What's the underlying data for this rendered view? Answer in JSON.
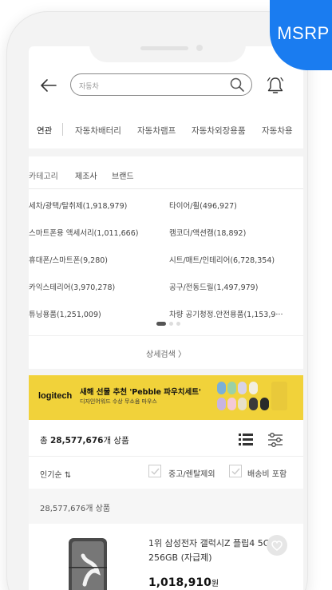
{
  "badge": {
    "label": "MSRP",
    "color": "#1a7cf0"
  },
  "header": {
    "search_value": "자동차"
  },
  "related": {
    "label": "연관",
    "keywords": [
      "자동차배터리",
      "자동차램프",
      "자동차외장용품",
      "자동차용"
    ]
  },
  "category_tabs": [
    "카테고리",
    "제조사",
    "브랜드"
  ],
  "categories": [
    "세차/광택/탈취제(1,918,979)",
    "타이어/휠(496,927)",
    "스마트폰용 액세서리(1,011,666)",
    "캠코더/액션캠(18,892)",
    "휴대폰/스마트폰(9,280)",
    "시트/매트/인테리어(6,728,354)",
    "카익스테리어(3,970,278)",
    "공구/전동드릴(1,497,979)",
    "튜닝용품(1,251,009)",
    "차량 공기청정.안전용품(1,153,9···"
  ],
  "detail_search": "상세검색 〉",
  "banner": {
    "brand": "logitech",
    "headline": "새해 선물 추천 'Pebble 파우치세트'",
    "subline": "디자인어워드 수상 무소음 마우스",
    "color": "#f1d23a"
  },
  "results": {
    "prefix": "총 ",
    "count": "28,577,676",
    "suffix": "개 상품"
  },
  "sort": {
    "label": "인기순 ⇅",
    "filters": [
      "중고/렌탈제외",
      "배송비 포함"
    ]
  },
  "summary": "28,577,676개 상품",
  "product": {
    "title": "1위 삼성전자 갤럭시Z 플립4 5G 256GB (자급제)",
    "price": "1,018,910",
    "currency": "원"
  },
  "icons": [
    "back-arrow-icon",
    "search-icon",
    "bell-icon",
    "list-view-icon",
    "filter-icon",
    "checkbox-icon",
    "heart-icon"
  ]
}
